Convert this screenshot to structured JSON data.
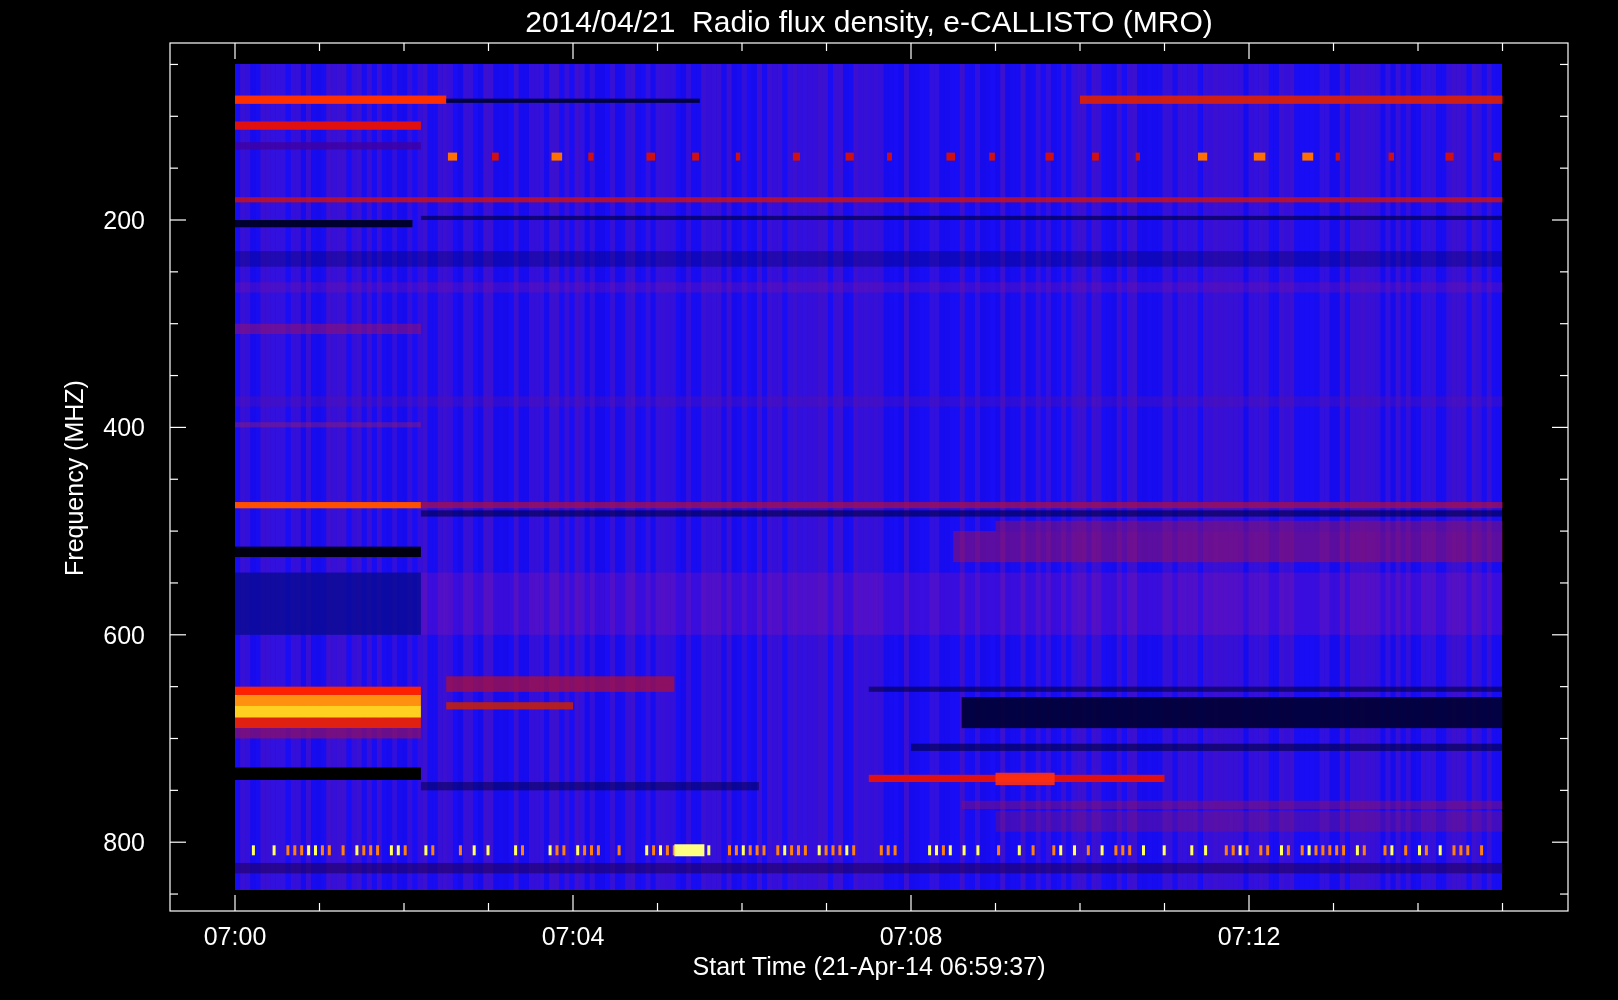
{
  "title": "2014/04/21  Radio flux density, e-CALLISTO (MRO)",
  "y_axis": {
    "label": "Frequency (MHZ)",
    "ticks": [
      "200",
      "400",
      "600",
      "800"
    ]
  },
  "x_axis": {
    "label": "Start Time (21-Apr-14 06:59:37)",
    "ticks": [
      "07:00",
      "07:04",
      "07:08",
      "07:12"
    ]
  }
}
